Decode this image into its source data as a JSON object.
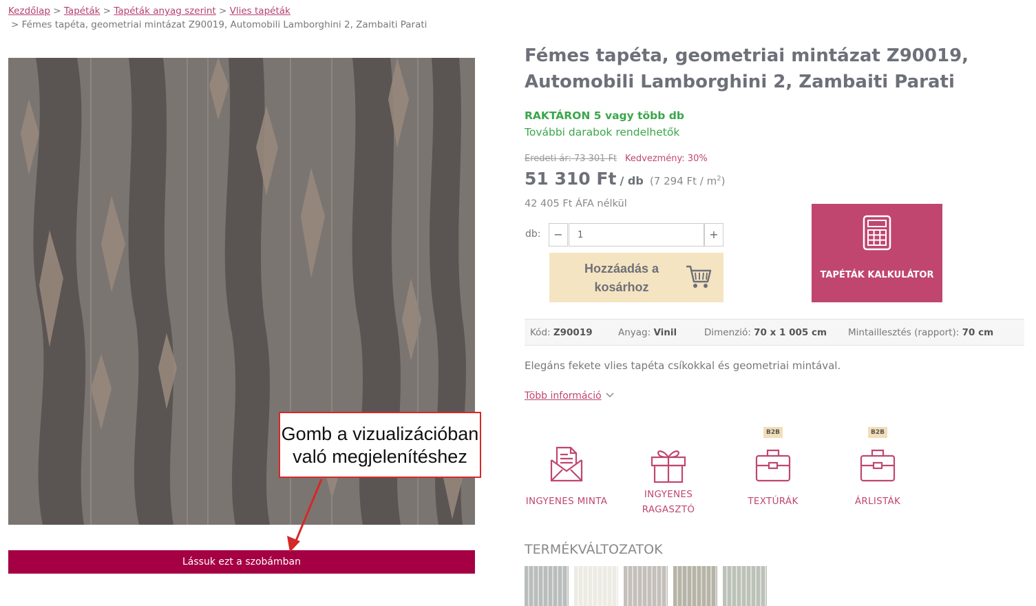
{
  "breadcrumb": {
    "items": [
      "Kezdőlap",
      "Tapéták",
      "Tapéták anyag szerint",
      "Vlies tapéták"
    ],
    "separator": ">",
    "current": "> Fémes tapéta, geometriai mintázat Z90019, Automobili Lamborghini 2, Zambaiti Parati"
  },
  "product": {
    "title": "Fémes tapéta, geometriai mintázat Z90019, Automobili Lamborghini 2, Zambaiti Parati",
    "stock_main": "RAKTÁRON 5 vagy több db",
    "stock_sub": "További darabok rendelhetők",
    "original_price": "Eredeti ár: 73 301 Ft",
    "discount": "Kedvezmény: 30%",
    "price": "51 310 Ft",
    "price_unit": "/ db",
    "price_per_sqm": "(7 294 Ft / m",
    "price_per_sqm_sup": "2",
    "price_per_sqm_close": ")",
    "net_price": "42 405 Ft ÁFA nélkül",
    "description": "Elegáns fekete vlies tapéta csíkokkal és geometriai mintával.",
    "more_info": "Több információ"
  },
  "quantity": {
    "label": "db:",
    "minus": "−",
    "plus": "+",
    "value": "1"
  },
  "cart": {
    "line1": "Hozzáadás a",
    "line2": "kosárhoz",
    "icon": "shopping-cart-icon"
  },
  "calculator": {
    "label": "TAPÉTÁK KALKULÁTOR",
    "icon": "calculator-icon"
  },
  "specs": [
    {
      "label": "Kód:",
      "value": "Z90019"
    },
    {
      "label": "Anyag:",
      "value": "Vinil"
    },
    {
      "label": "Dimenzió:",
      "value": "70 x 1 005 cm"
    },
    {
      "label": "Mintaillesztés (rapport):",
      "value": "70 cm"
    }
  ],
  "features": [
    {
      "label1": "INGYENES MINTA",
      "label2": "",
      "icon": "envelope-letter-icon",
      "badge": ""
    },
    {
      "label1": "INGYENES",
      "label2": "RAGASZTÓ",
      "icon": "gift-icon",
      "badge": ""
    },
    {
      "label1": "TEXTÚRÁK",
      "label2": "",
      "icon": "briefcase-icon",
      "badge": "B2B"
    },
    {
      "label1": "ÁRLISTÁK",
      "label2": "",
      "icon": "briefcase-icon",
      "badge": "B2B"
    }
  ],
  "room_button": "Lássuk ezt a szobámban",
  "annotation": {
    "line1": "Gomb a vizualizációban",
    "line2": "való megjelenítéshez"
  },
  "variants": {
    "title": "TERMÉKVÁLTOZATOK",
    "swatch_colors": [
      "#b9bdbb",
      "#ecebe4",
      "#c4bfba",
      "#b6b3a7",
      "#bcc2b8"
    ]
  },
  "colors": {
    "accent": "#c0466f",
    "room_button": "#a50043",
    "stock_green": "#3aa64a",
    "cart_bg": "#f5e4c1"
  }
}
